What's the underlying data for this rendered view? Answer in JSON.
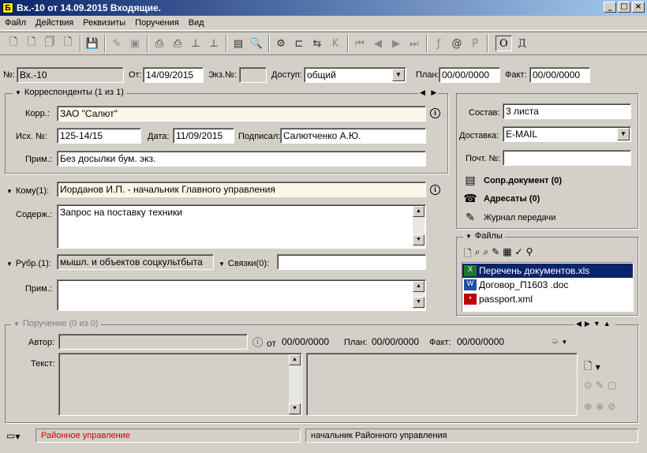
{
  "window": {
    "title": "Вх.-10 от 14.09.2015 Входящие.",
    "app_icon": "Б"
  },
  "menu": [
    "Файл",
    "Действия",
    "Реквизиты",
    "Поручения",
    "Вид"
  ],
  "toolbar": {
    "o_label": "О",
    "d_label": "Д"
  },
  "header": {
    "no_label": "№:",
    "no_value": "Вх.-10",
    "ot_label": "От:",
    "ot_value": "14/09/2015",
    "ekz_label": "Экз.№:",
    "ekz_value": "",
    "dostup_label": "Доступ:",
    "dostup_value": "общий",
    "plan_label": "План:",
    "plan_value": "00/00/0000",
    "fakt_label": "Факт:",
    "fakt_value": "00/00/0000"
  },
  "correspondents": {
    "title": "Корреспонденты (1 из 1)",
    "korr_label": "Корр.:",
    "korr_value": "ЗАО \"Салют\"",
    "isx_label": "Исх. №:",
    "isx_value": "125-14/15",
    "data_label": "Дата:",
    "data_value": "11/09/2015",
    "podpisal_label": "Подписал:",
    "podpisal_value": "Салютченко А.Ю.",
    "prim_label": "Прим.:",
    "prim_value": "Без досылки бум. экз."
  },
  "right_panel": {
    "sostav_label": "Состав:",
    "sostav_value": "3 листа",
    "dostavka_label": "Доставка:",
    "dostavka_value": "E-MAIL",
    "pocht_label": "Почт. №:",
    "pocht_value": "",
    "links": [
      {
        "label": "Сопр.документ (0)",
        "icon": "linked-doc-icon"
      },
      {
        "label": "Адресаты (0)",
        "icon": "recipients-icon"
      },
      {
        "label": "Журнал передачи",
        "icon": "journal-icon"
      }
    ]
  },
  "main": {
    "komu_label": "Кому(1):",
    "komu_value": "Иорданов И.П. - начальник Главного управления",
    "soderzh_label": "Содерж.:",
    "soderzh_value": "Запрос на поставку техники",
    "rubr_label": "Рубр.(1):",
    "rubr_value": "мышл. и объектов соцкультбыта",
    "svyazki_label": "Связки(0):",
    "svyazki_value": "",
    "prim_label": "Прим.:",
    "prim_value": ""
  },
  "files": {
    "title": "Файлы",
    "items": [
      {
        "name": "Перечень документов.xls",
        "icon": "excel-file-icon",
        "selected": true
      },
      {
        "name": "Договор_П1603 .doc",
        "icon": "word-file-icon",
        "selected": false
      },
      {
        "name": "passport.xml",
        "icon": "xml-file-icon",
        "selected": false
      }
    ]
  },
  "assignment": {
    "title": "Поручение (0 из 0)",
    "avtor_label": "Автор:",
    "avtor_value": "",
    "ot_label": "от",
    "ot_value": "00/00/0000",
    "plan_label": "План:",
    "plan_value": "00/00/0000",
    "fakt_label": "Факт:",
    "fakt_value": "00/00/0000",
    "tekst_label": "Текст:"
  },
  "statusbar": {
    "left": "Районное управление",
    "right": "начальник Районного управления",
    "left_color": "#d00000"
  }
}
